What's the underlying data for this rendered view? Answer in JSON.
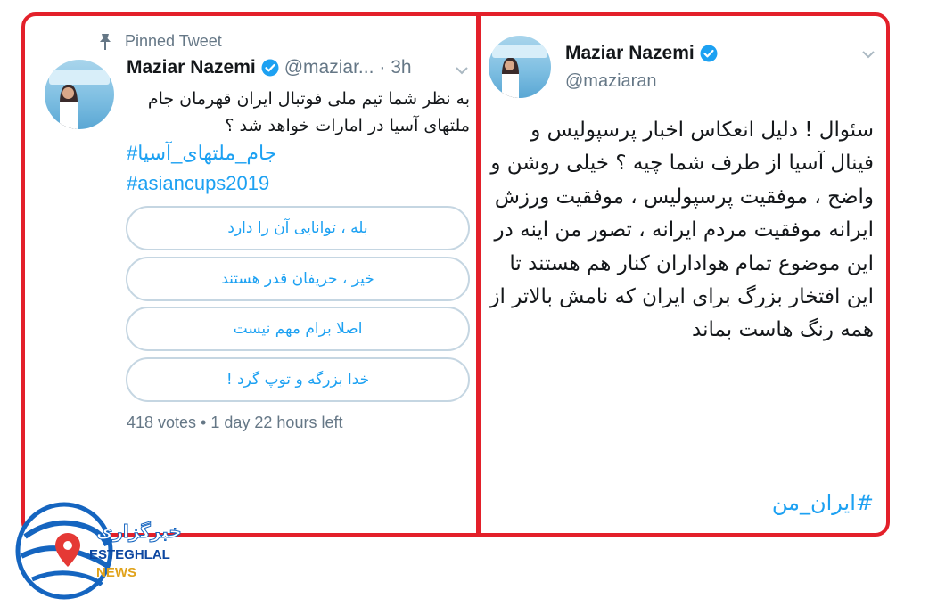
{
  "left_tweet": {
    "pinned_label": "Pinned Tweet",
    "author_name": "Maziar Nazemi",
    "handle": "@maziar...",
    "time": "· 3h",
    "text": "به نظر شما تیم ملی فوتبال ایران قهرمان جام ملتهای آسیا در امارات خواهد شد ؟",
    "hashtags": [
      "#جام_ملتهای_آسیا",
      "#asiancups2019"
    ],
    "poll_options": [
      "بله ، توانایی آن را دارد",
      "خیر ، حریفان قدر  هستند",
      "اصلا برام مهم نیست",
      "خدا بزرگه و توپ گرد !"
    ],
    "poll_meta": "418 votes • 1 day 22 hours left"
  },
  "right_tweet": {
    "author_name": "Maziar Nazemi",
    "handle": "@maziaran",
    "text": "سئوال ! دلیل انعکاس اخبار پرسپولیس و فینال آسیا از طرف شما چیه ؟ خیلی روشن و واضح ، موفقیت پرسپولیس ، موفقیت ورزش ایرانه موفقیت مردم ایرانه ، تصور من اینه در این موضوع تمام هواداران کنار هم هستند تا این افتخار بزرگ برای ایران که نامش بالاتر  از همه رنگ هاست بماند",
    "hashtag": "#ایران_من"
  },
  "watermark": {
    "fa_text": "خبرگزاری",
    "line1": "ESTEGHLAL",
    "line2": "NEWS"
  },
  "colors": {
    "frame_red": "#e3202a",
    "twitter_blue": "#1da1f2",
    "muted_gray": "#657786"
  },
  "icons": [
    "pin-icon",
    "verified-badge-icon",
    "chevron-down-icon",
    "globe-logo-icon"
  ]
}
